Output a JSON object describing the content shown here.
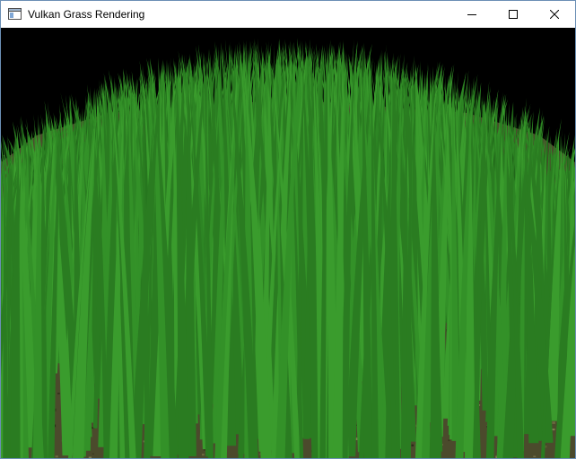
{
  "window": {
    "title": "Vulkan Grass Rendering",
    "app_icon": "window-app-icon",
    "controls": {
      "minimize_icon": "minimize-icon",
      "maximize_icon": "maximize-icon",
      "close_icon": "close-icon"
    }
  },
  "scene": {
    "description_colors": {
      "background": "#000000",
      "ground": "#4a4a2a",
      "grass_dark": "#1e5c16",
      "grass_mid": "#2f8a24",
      "grass_light": "#3aa02c"
    }
  }
}
